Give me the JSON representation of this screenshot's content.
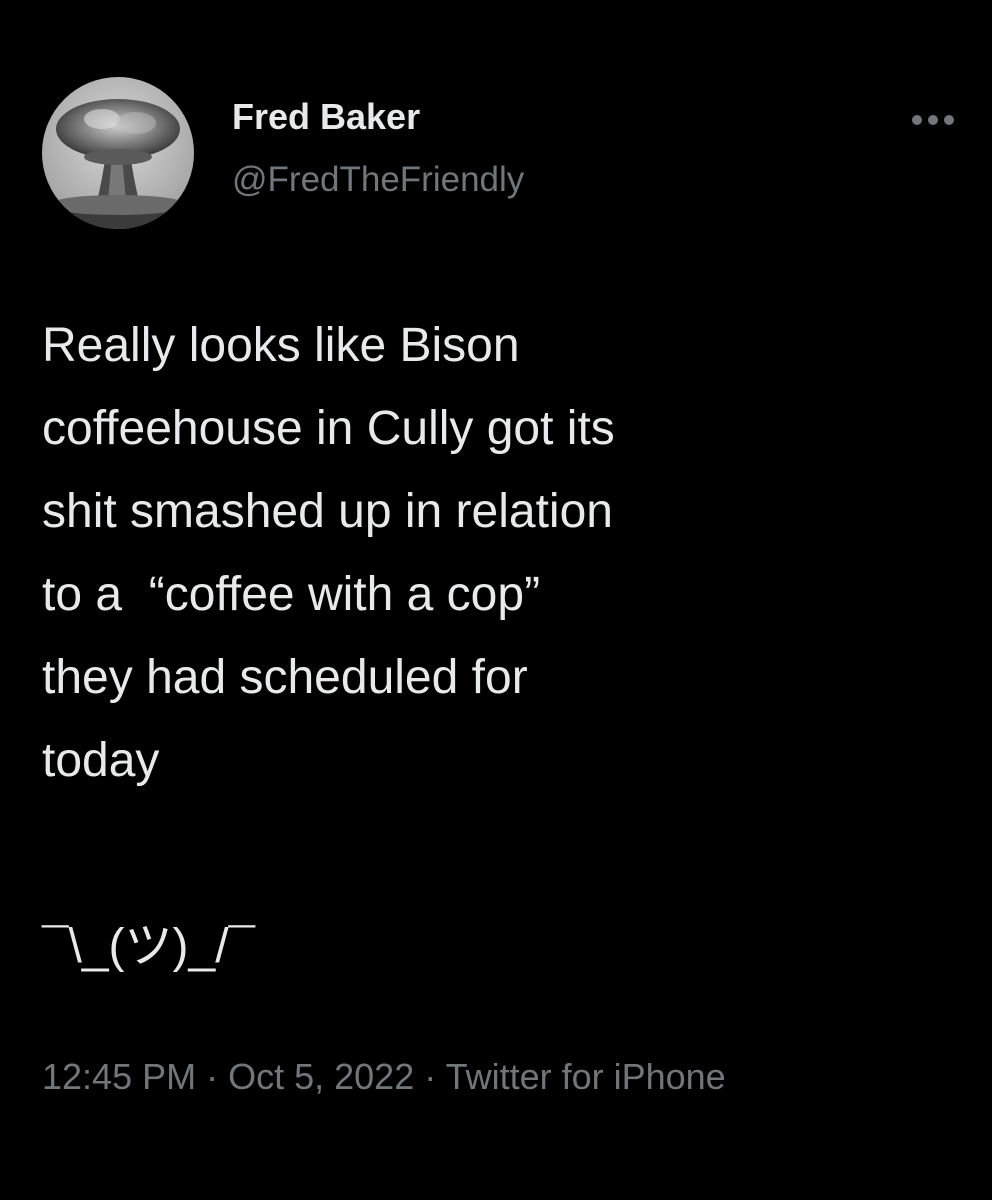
{
  "tweet": {
    "display_name": "Fred Baker",
    "handle": "@FredTheFriendly",
    "body_lines": "Really looks like Bison\ncoffeehouse in Cully got its\nshit smashed up in relation\nto a  “coffee with a cop”\nthey had scheduled for\ntoday",
    "shrug": "¯\\_(ツ)_/¯",
    "time": "12:45 PM",
    "separator": " · ",
    "date": "Oct 5, 2022",
    "source": "Twitter for iPhone"
  },
  "icons": {
    "more": "more-horizontal-icon",
    "avatar": "mushroom-cloud-avatar"
  },
  "colors": {
    "background": "#000000",
    "primary_text": "#e7e9ea",
    "secondary_text": "#71767b"
  }
}
